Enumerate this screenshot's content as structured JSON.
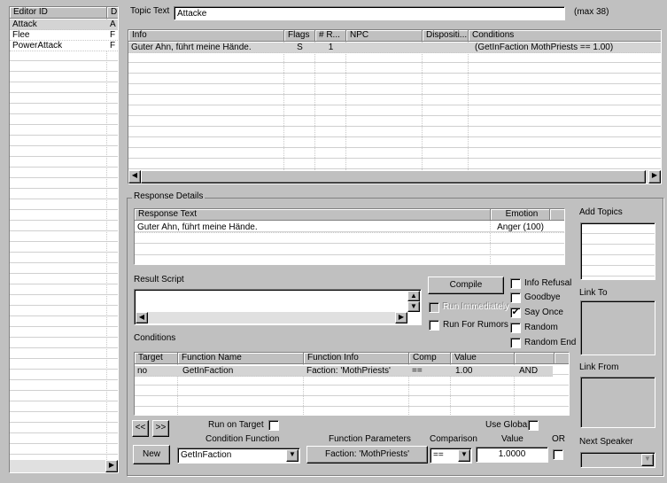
{
  "topics": {
    "columns": [
      "Editor ID",
      "D"
    ],
    "items": [
      {
        "id": "Attack",
        "d": "A"
      },
      {
        "id": "Flee",
        "d": "F"
      },
      {
        "id": "PowerAttack",
        "d": "F"
      }
    ],
    "selected": 0
  },
  "topic_text": {
    "label": "Topic Text",
    "value": "Attacke",
    "max": "(max 38)"
  },
  "info": {
    "columns": [
      "Info",
      "Flags",
      "# R...",
      "NPC",
      "Dispositi...",
      "Conditions"
    ],
    "rows": [
      {
        "info": "Guter Ahn, führt meine Hände.",
        "flags": "S",
        "r": "1",
        "npc": "",
        "disp": "",
        "cond": "(GetInFaction MothPriests == 1.00)"
      }
    ]
  },
  "response": {
    "group": "Response Details",
    "columns": [
      "Response Text",
      "Emotion"
    ],
    "rows": [
      {
        "text": "Guter Ahn, führt meine Hände.",
        "emotion": "Anger (100)"
      }
    ]
  },
  "add_topics": "Add Topics",
  "link_to": "Link To",
  "link_from": "Link From",
  "next_speaker": "Next Speaker",
  "result_script": {
    "label": "Result Script",
    "value": ""
  },
  "compile": "Compile",
  "checks": {
    "run_immediately": {
      "label": "Run Immediately",
      "checked": false,
      "disabled": true
    },
    "run_for_rumors": {
      "label": "Run For Rumors",
      "checked": false
    },
    "info_refusal": {
      "label": "Info Refusal",
      "checked": false
    },
    "goodbye": {
      "label": "Goodbye",
      "checked": false
    },
    "say_once": {
      "label": "Say Once",
      "checked": true
    },
    "random": {
      "label": "Random",
      "checked": false
    },
    "random_end": {
      "label": "Random End",
      "checked": false
    }
  },
  "conditions": {
    "label": "Conditions",
    "columns": [
      "Target",
      "Function Name",
      "Function Info",
      "Comp",
      "Value",
      ""
    ],
    "rows": [
      {
        "target": "no",
        "fn": "GetInFaction",
        "info": "Faction: 'MothPriests'",
        "comp": "==",
        "value": "1.00",
        "op": "AND"
      }
    ]
  },
  "cond_edit": {
    "prev": "<<",
    "next": ">>",
    "run_on_target": "Run on Target",
    "use_global": "Use Global",
    "condition_function": "Condition Function",
    "function_parameters": "Function Parameters",
    "comparison": "Comparison",
    "value_label": "Value",
    "or": "OR",
    "new": "New",
    "function_value": "GetInFaction",
    "params_value": "Faction: 'MothPriests'",
    "comparison_value": "==",
    "value": "1.0000"
  }
}
